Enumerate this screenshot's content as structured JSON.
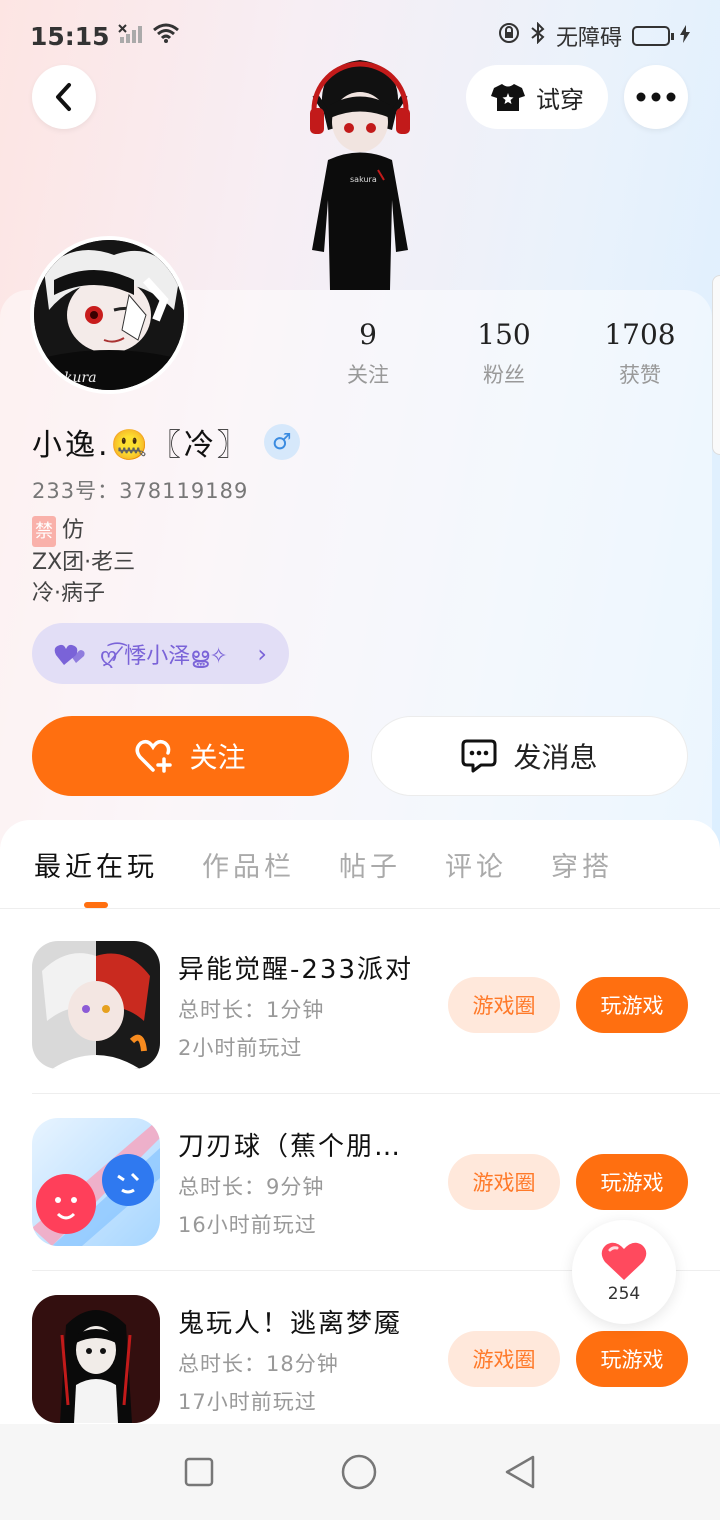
{
  "status_bar": {
    "time": "15:15",
    "accessibility_label": "无障碍"
  },
  "header": {
    "try_on_label": "试穿"
  },
  "profile": {
    "stats": [
      {
        "value": "9",
        "label": "关注"
      },
      {
        "value": "150",
        "label": "粉丝"
      },
      {
        "value": "1708",
        "label": "获赞"
      }
    ],
    "nickname": "小逸.🤐〖冷〗",
    "gender_symbol": "♂",
    "uid": "233号：378119189",
    "bio_lines": [
      "禁 仿",
      "ZX团·老三",
      "冷·病子"
    ],
    "bio_mark": "禁",
    "bio_line1_rest": "仿",
    "relation_label": "ღ͡ ̸悸小泽ൠ✧"
  },
  "actions": {
    "follow_label": "关注",
    "message_label": "发消息"
  },
  "tabs": [
    {
      "label": "最近在玩",
      "active": true
    },
    {
      "label": "作品栏",
      "active": false
    },
    {
      "label": "帖子",
      "active": false
    },
    {
      "label": "评论",
      "active": false
    },
    {
      "label": "穿搭",
      "active": false
    }
  ],
  "games": [
    {
      "title": "异能觉醒-233派对",
      "duration": "总时长：1分钟",
      "last_played": "2小时前玩过",
      "circle_label": "游戏圈",
      "play_label": "玩游戏"
    },
    {
      "title": "刀刃球（蕉个朋友）",
      "duration": "总时长：9分钟",
      "last_played": "16小时前玩过",
      "circle_label": "游戏圈",
      "play_label": "玩游戏"
    },
    {
      "title": "鬼玩人！逃离梦魇",
      "duration": "总时长：18分钟",
      "last_played": "17小时前玩过",
      "circle_label": "游戏圈",
      "play_label": "玩游戏"
    }
  ],
  "like_float": {
    "count": "254",
    "icon": "heart-icon",
    "color": "#ff4a5e"
  },
  "colors": {
    "accent": "#ff6f10",
    "accent_soft": "#ffe8db",
    "relation_bg": "#e2def6"
  }
}
